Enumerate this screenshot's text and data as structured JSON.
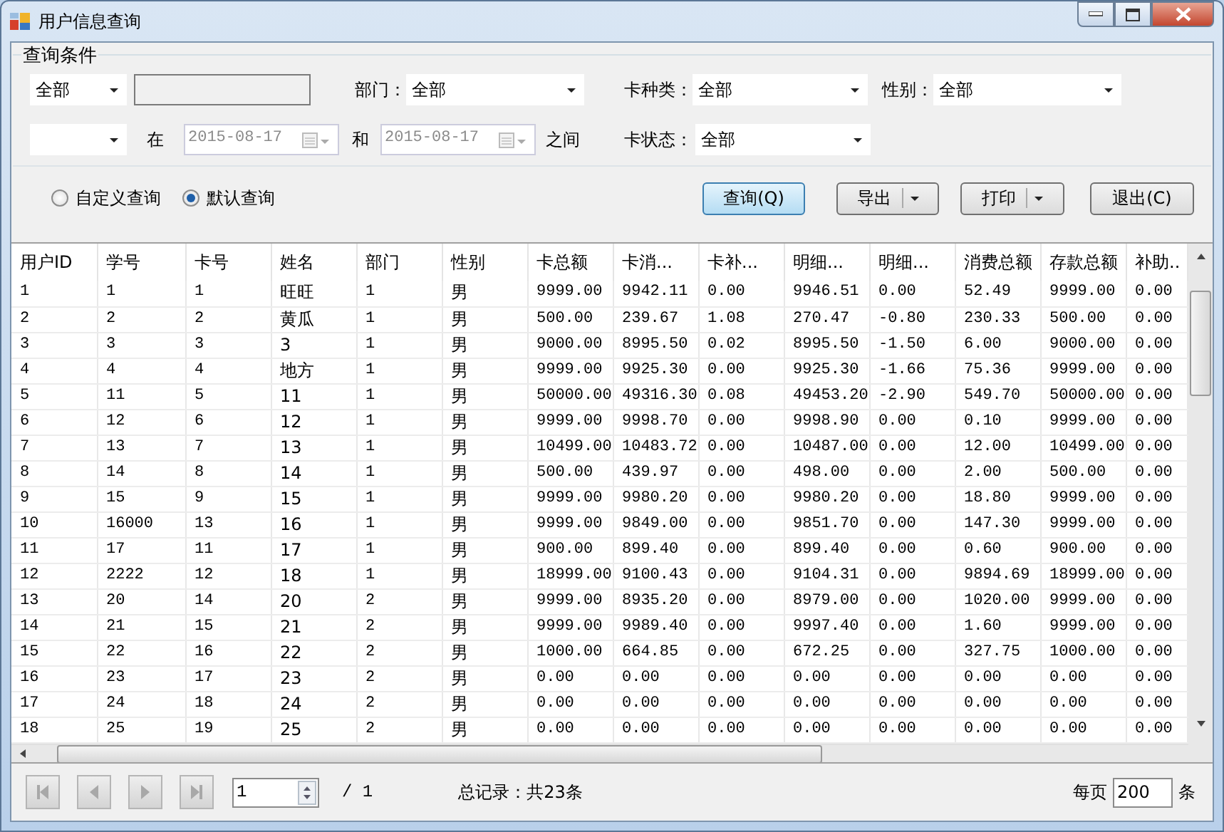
{
  "window": {
    "title": "用户信息查询"
  },
  "query_group": {
    "title": "查询条件",
    "row_1": [
      {
        "kind": "select",
        "value": "全部"
      },
      {
        "kind": "input"
      },
      {
        "kind": "label",
        "text": "部门："
      },
      {
        "kind": "select",
        "value": "全部"
      },
      {
        "kind": "label",
        "text": "卡种类："
      },
      {
        "kind": "select",
        "value": "全部"
      },
      {
        "kind": "label",
        "text": "性别："
      },
      {
        "kind": "select",
        "value": "全部"
      }
    ],
    "row_2": [
      {
        "kind": "select"
      },
      {
        "kind": "label",
        "text": "在"
      },
      {
        "kind": "date",
        "value": "2015-08-17",
        "disabled": true
      },
      {
        "kind": "label",
        "text": "和"
      },
      {
        "kind": "date",
        "value": "2015-08-17",
        "disabled": true
      },
      {
        "kind": "label",
        "text": "之间"
      },
      {
        "kind": "label",
        "text": "卡状态："
      },
      {
        "kind": "select",
        "value": "全部"
      }
    ],
    "radios": [
      {
        "label": "自定义查询",
        "selected": false
      },
      {
        "label": "默认查询",
        "selected": true
      }
    ],
    "buttons": [
      {
        "label": "查询(Q)",
        "kind": "default"
      },
      {
        "label": "导出",
        "kind": "split"
      },
      {
        "label": "打印",
        "kind": "split"
      },
      {
        "label": "退出(C)",
        "kind": "plain"
      }
    ]
  },
  "table": {
    "columns": [
      "用户ID",
      "学号",
      "卡号",
      "姓名",
      "部门",
      "性别",
      "卡总额",
      "卡消...",
      "卡补...",
      "明细...",
      "明细...",
      "消费总额",
      "存款总额",
      "补助.."
    ],
    "rows": [
      [
        "1",
        "1",
        "1",
        "旺旺",
        "1",
        "男",
        "9999.00",
        "9942.11",
        "0.00",
        "9946.51",
        "0.00",
        "52.49",
        "9999.00",
        "0.00"
      ],
      [
        "2",
        "2",
        "2",
        "黄瓜",
        "1",
        "男",
        "500.00",
        "239.67",
        "1.08",
        "270.47",
        "-0.80",
        "230.33",
        "500.00",
        "0.00"
      ],
      [
        "3",
        "3",
        "3",
        "3",
        "1",
        "男",
        "9000.00",
        "8995.50",
        "0.02",
        "8995.50",
        "-1.50",
        "6.00",
        "9000.00",
        "0.00"
      ],
      [
        "4",
        "4",
        "4",
        "地方",
        "1",
        "男",
        "9999.00",
        "9925.30",
        "0.00",
        "9925.30",
        "-1.66",
        "75.36",
        "9999.00",
        "0.00"
      ],
      [
        "5",
        "11",
        "5",
        "11",
        "1",
        "男",
        "50000.00",
        "49316.30",
        "0.08",
        "49453.20",
        "-2.90",
        "549.70",
        "50000.00",
        "0.00"
      ],
      [
        "6",
        "12",
        "6",
        "12",
        "1",
        "男",
        "9999.00",
        "9998.70",
        "0.00",
        "9998.90",
        "0.00",
        "0.10",
        "9999.00",
        "0.00"
      ],
      [
        "7",
        "13",
        "7",
        "13",
        "1",
        "男",
        "10499.00",
        "10483.72",
        "0.00",
        "10487.00",
        "0.00",
        "12.00",
        "10499.00",
        "0.00"
      ],
      [
        "8",
        "14",
        "8",
        "14",
        "1",
        "男",
        "500.00",
        "439.97",
        "0.00",
        "498.00",
        "0.00",
        "2.00",
        "500.00",
        "0.00"
      ],
      [
        "9",
        "15",
        "9",
        "15",
        "1",
        "男",
        "9999.00",
        "9980.20",
        "0.00",
        "9980.20",
        "0.00",
        "18.80",
        "9999.00",
        "0.00"
      ],
      [
        "10",
        "16000",
        "13",
        "16",
        "1",
        "男",
        "9999.00",
        "9849.00",
        "0.00",
        "9851.70",
        "0.00",
        "147.30",
        "9999.00",
        "0.00"
      ],
      [
        "11",
        "17",
        "11",
        "17",
        "1",
        "男",
        "900.00",
        "899.40",
        "0.00",
        "899.40",
        "0.00",
        "0.60",
        "900.00",
        "0.00"
      ],
      [
        "12",
        "2222",
        "12",
        "18",
        "1",
        "男",
        "18999.00",
        "9100.43",
        "0.00",
        "9104.31",
        "0.00",
        "9894.69",
        "18999.00",
        "0.00"
      ],
      [
        "13",
        "20",
        "14",
        "20",
        "2",
        "男",
        "9999.00",
        "8935.20",
        "0.00",
        "8979.00",
        "0.00",
        "1020.00",
        "9999.00",
        "0.00"
      ],
      [
        "14",
        "21",
        "15",
        "21",
        "2",
        "男",
        "9999.00",
        "9989.40",
        "0.00",
        "9997.40",
        "0.00",
        "1.60",
        "9999.00",
        "0.00"
      ],
      [
        "15",
        "22",
        "16",
        "22",
        "2",
        "男",
        "1000.00",
        "664.85",
        "0.00",
        "672.25",
        "0.00",
        "327.75",
        "1000.00",
        "0.00"
      ],
      [
        "16",
        "23",
        "17",
        "23",
        "2",
        "男",
        "0.00",
        "0.00",
        "0.00",
        "0.00",
        "0.00",
        "0.00",
        "0.00",
        "0.00"
      ],
      [
        "17",
        "24",
        "18",
        "24",
        "2",
        "男",
        "0.00",
        "0.00",
        "0.00",
        "0.00",
        "0.00",
        "0.00",
        "0.00",
        "0.00"
      ],
      [
        "18",
        "25",
        "19",
        "25",
        "2",
        "男",
        "0.00",
        "0.00",
        "0.00",
        "0.00",
        "0.00",
        "0.00",
        "0.00",
        "0.00"
      ]
    ]
  },
  "pager": {
    "page": "1",
    "page_count": "/ 1",
    "total": "总记录：共23条",
    "per_page_label": "每页",
    "per_page": "200",
    "per_page_unit": "条"
  }
}
